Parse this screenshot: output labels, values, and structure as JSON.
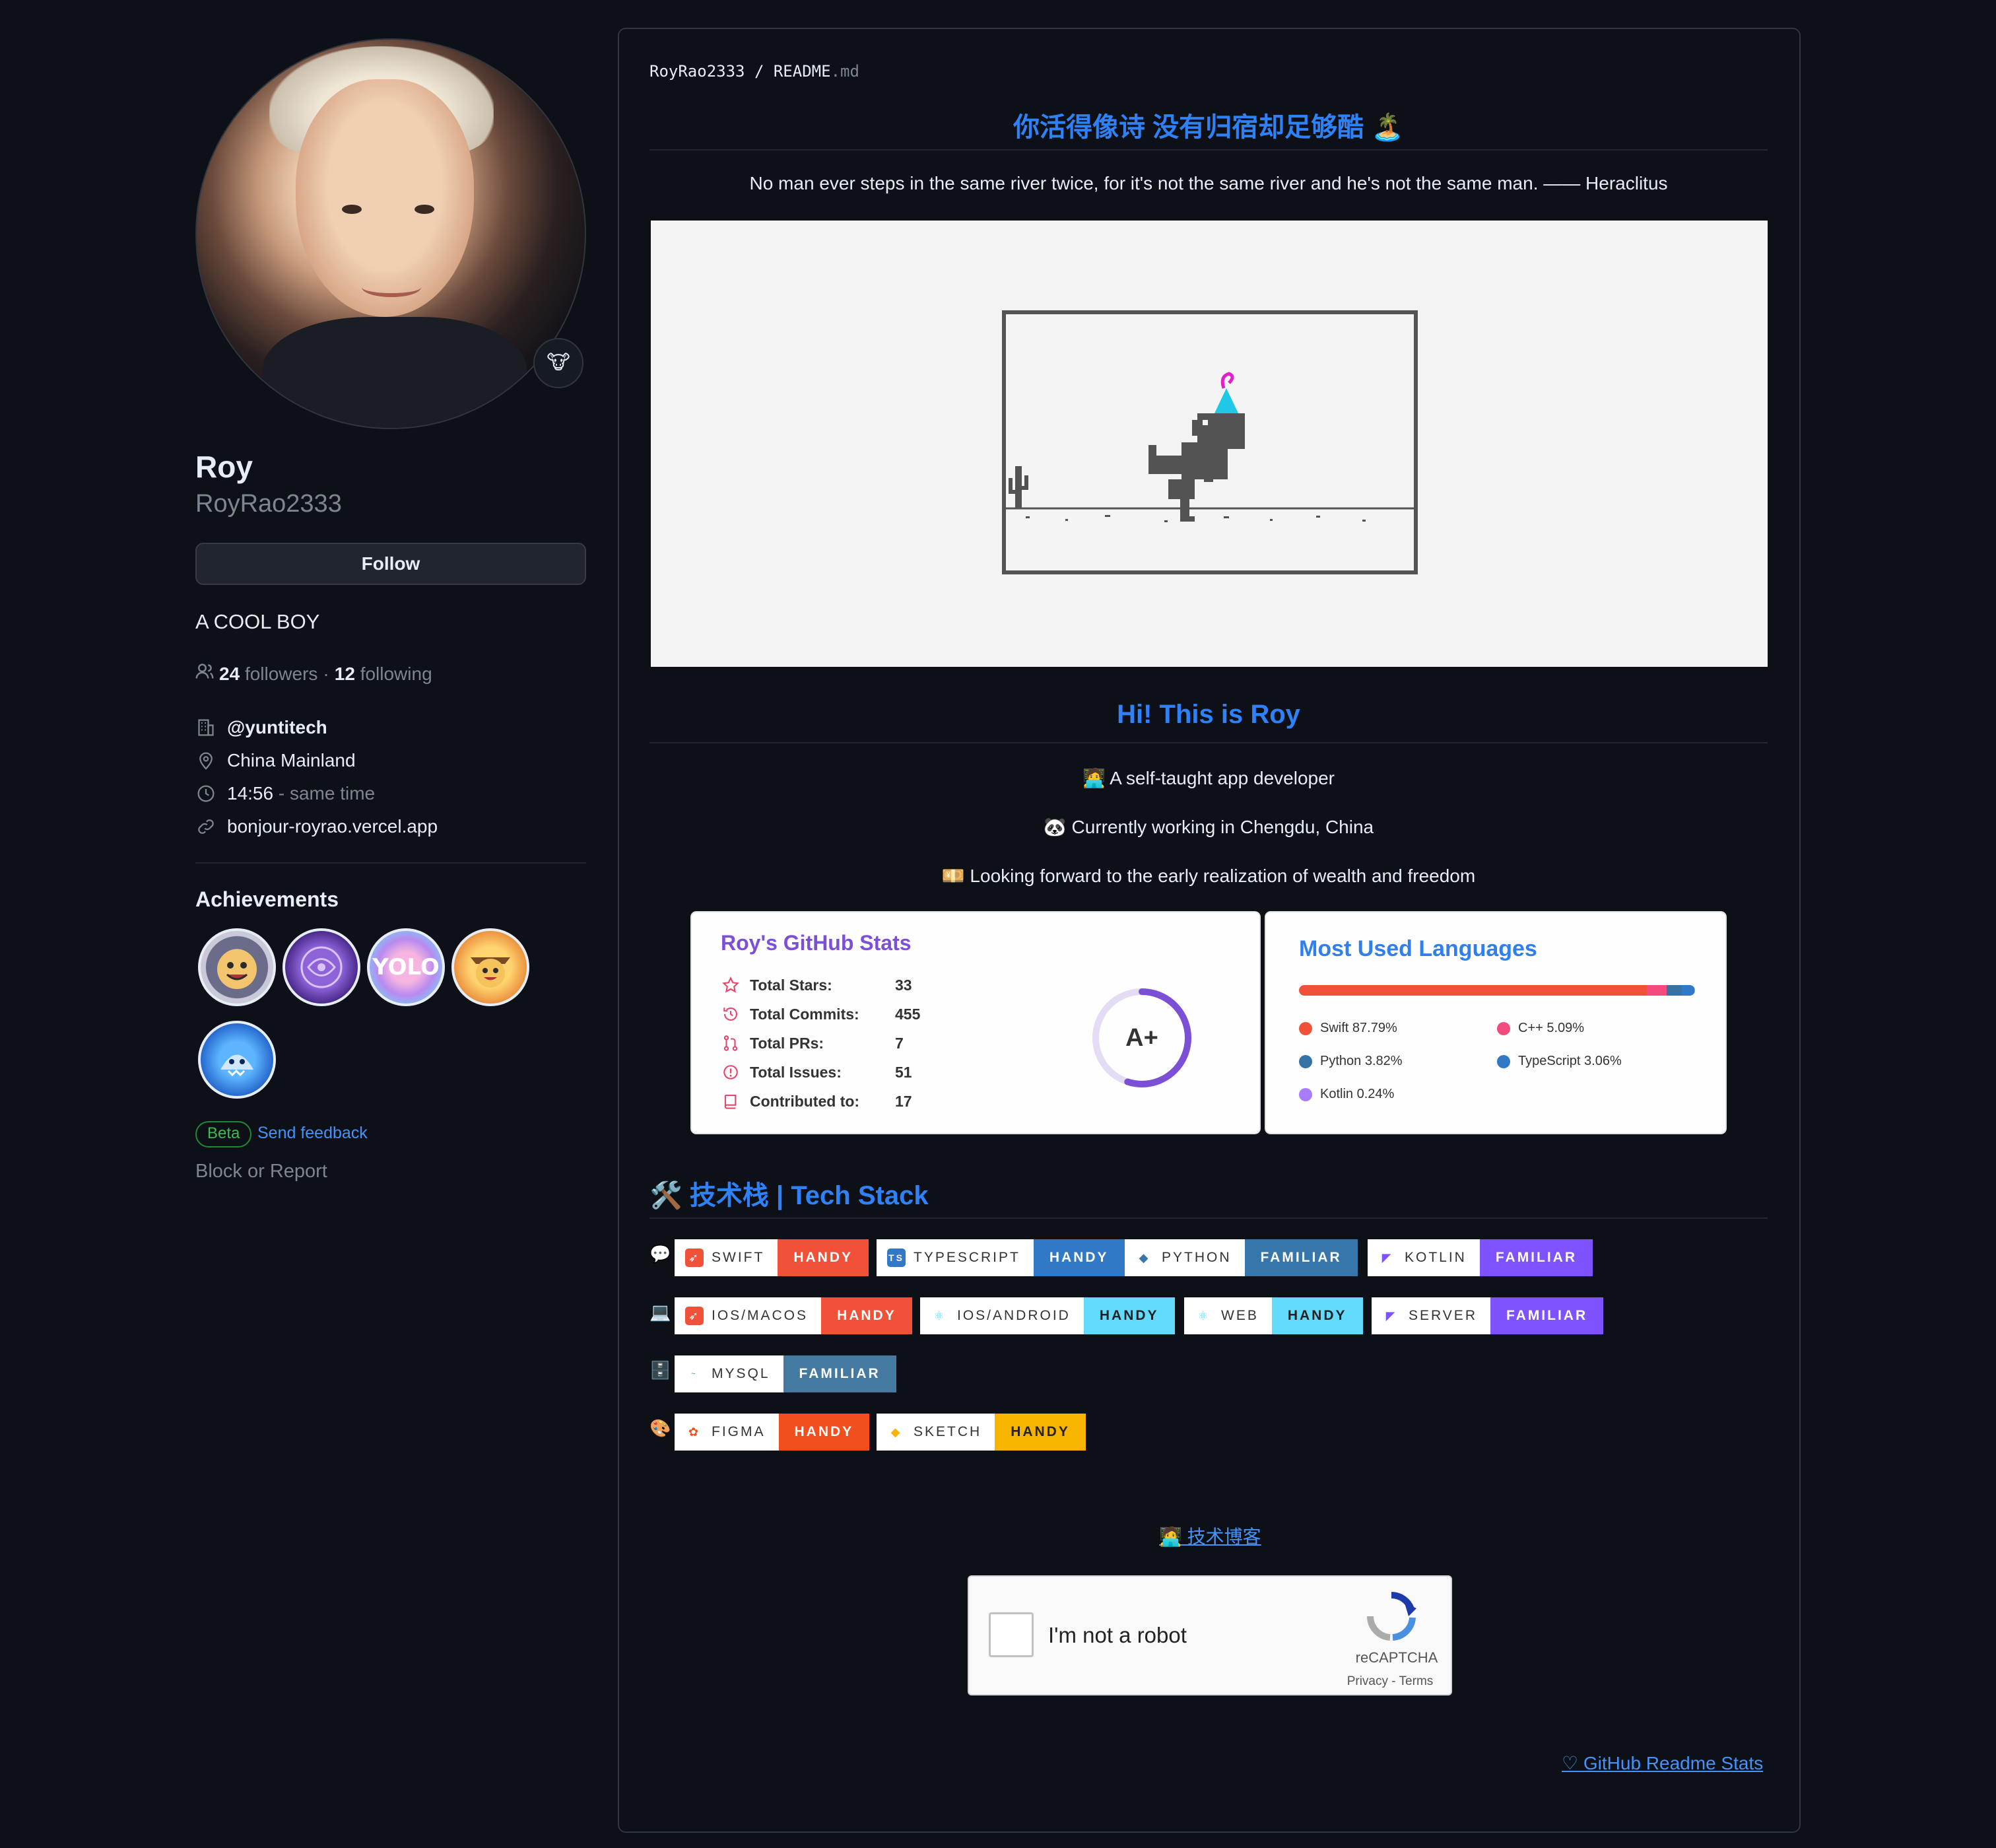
{
  "profile": {
    "name": "Roy",
    "login": "RoyRao2333",
    "follow_label": "Follow",
    "bio": "A COOL BOY",
    "followers_count": "24",
    "followers_label": "followers",
    "separator": "·",
    "following_count": "12",
    "following_label": "following",
    "company": "@yuntitech",
    "location": "China Mainland",
    "local_time": "14:56",
    "time_note": "- same time",
    "website": "bonjour-royrao.vercel.app",
    "achievements_title": "Achievements",
    "beta_label": "Beta",
    "feedback_label": "Send feedback",
    "block_label": "Block or Report"
  },
  "readme": {
    "crumb_user": "RoyRao2333",
    "crumb_sep": "/",
    "crumb_file": "README",
    "crumb_ext": ".md",
    "title_cn": "你活得像诗 没有归宿却足够酷 🏝️",
    "quote": "No man ever steps in the same river twice, for it's not the same river and he's not the same man. —— Heraclitus",
    "hi_title": "Hi! This is Roy",
    "intro_1": "🧑‍💻 A self-taught app developer",
    "intro_2": "🐼 Currently working in Chengdu, China",
    "intro_3": "💴 Looking forward to the early realization of wealth and freedom",
    "tech_title": "🛠️ 技术栈 | Tech Stack",
    "blog_link": "🧑‍💻 技术博客",
    "stats_link": "♡ GitHub Readme Stats"
  },
  "stats_card": {
    "title": "Roy's GitHub Stats",
    "rows": [
      {
        "label": "Total Stars:",
        "value": "33"
      },
      {
        "label": "Total Commits:",
        "value": "455"
      },
      {
        "label": "Total PRs:",
        "value": "7"
      },
      {
        "label": "Total Issues:",
        "value": "51"
      },
      {
        "label": "Contributed to:",
        "value": "17"
      }
    ],
    "grade": "A+",
    "grade_progress": 0.55,
    "accent": "#7b4fd6"
  },
  "lang_card": {
    "title": "Most Used Languages",
    "languages": [
      {
        "name": "Swift",
        "percent": "87.79%",
        "value": 87.79,
        "color": "#F05138"
      },
      {
        "name": "C++",
        "percent": "5.09%",
        "value": 5.09,
        "color": "#f34b7d"
      },
      {
        "name": "Python",
        "percent": "3.82%",
        "value": 3.82,
        "color": "#3572A5"
      },
      {
        "name": "TypeScript",
        "percent": "3.06%",
        "value": 3.06,
        "color": "#3178c6"
      },
      {
        "name": "Kotlin",
        "percent": "0.24%",
        "value": 0.24,
        "color": "#A97BFF"
      }
    ]
  },
  "tech_rows": [
    {
      "emoji": "💬",
      "badges": [
        {
          "label": "SWIFT",
          "level": "HANDY",
          "icon": "swift-icon"
        },
        {
          "label": "TYPESCRIPT",
          "level": "HANDY",
          "icon": "typescript-icon"
        },
        {
          "label": "PYTHON",
          "level": "FAMILIAR",
          "icon": "python-icon"
        },
        {
          "label": "KOTLIN",
          "level": "FAMILIAR",
          "icon": "kotlin-icon"
        }
      ]
    },
    {
      "emoji": "💻",
      "badges": [
        {
          "label": "IOS/MACOS",
          "level": "HANDY",
          "icon": "swift-icon"
        },
        {
          "label": "IOS/ANDROID",
          "level": "HANDY",
          "icon": "react-icon"
        },
        {
          "label": "WEB",
          "level": "HANDY",
          "icon": "react-icon"
        },
        {
          "label": "SERVER",
          "level": "FAMILIAR",
          "icon": "kotlin-icon"
        }
      ]
    },
    {
      "emoji": "🗄️",
      "badges": [
        {
          "label": "MYSQL",
          "level": "FAMILIAR",
          "icon": "mysql-icon"
        }
      ]
    },
    {
      "emoji": "🎨",
      "badges": [
        {
          "label": "FIGMA",
          "level": "HANDY",
          "icon": "figma-icon"
        },
        {
          "label": "SKETCH",
          "level": "HANDY",
          "icon": "sketch-icon"
        }
      ]
    }
  ],
  "captcha": {
    "label": "I'm not a robot",
    "brand": "reCAPTCHA",
    "privacy": "Privacy",
    "dash": " - ",
    "terms": "Terms"
  }
}
